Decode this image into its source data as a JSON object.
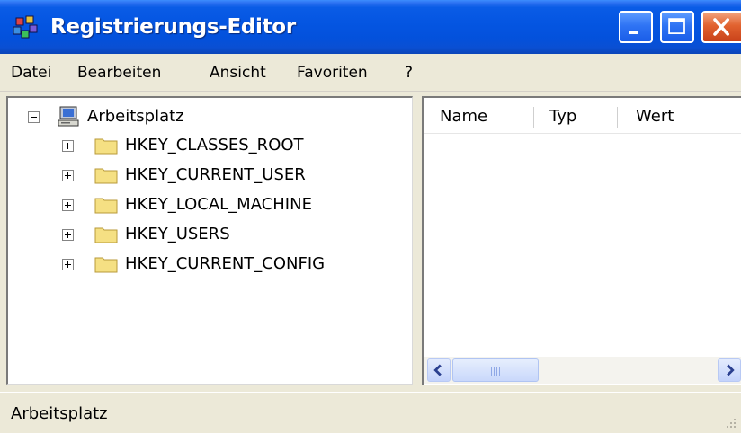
{
  "window": {
    "title": "Registrierungs-Editor",
    "title_icon": "registry-editor-icon",
    "controls": [
      "minimize-icon",
      "maximize-icon",
      "close-icon"
    ],
    "colors": {
      "titlebar": "#0556e2",
      "close": "#e1622f",
      "frame": "#ece9d8",
      "folder": "#f5e083"
    }
  },
  "menu": {
    "items": [
      {
        "label": "Datei"
      },
      {
        "label": "Bearbeiten"
      },
      {
        "label": "Ansicht"
      },
      {
        "label": "Favoriten"
      },
      {
        "label": "?"
      }
    ]
  },
  "tree": {
    "root": {
      "label": "Arbeitsplatz",
      "icon": "computer-icon",
      "expanded": true
    },
    "children": [
      {
        "label": "HKEY_CLASSES_ROOT",
        "icon": "folder-icon",
        "expanded": false
      },
      {
        "label": "HKEY_CURRENT_USER",
        "icon": "folder-icon",
        "expanded": false
      },
      {
        "label": "HKEY_LOCAL_MACHINE",
        "icon": "folder-icon",
        "expanded": false
      },
      {
        "label": "HKEY_USERS",
        "icon": "folder-icon",
        "expanded": false
      },
      {
        "label": "HKEY_CURRENT_CONFIG",
        "icon": "folder-icon",
        "expanded": false
      }
    ]
  },
  "list": {
    "columns": [
      "Name",
      "Typ",
      "Wert"
    ],
    "rows": []
  },
  "status": {
    "text": "Arbeitsplatz"
  }
}
